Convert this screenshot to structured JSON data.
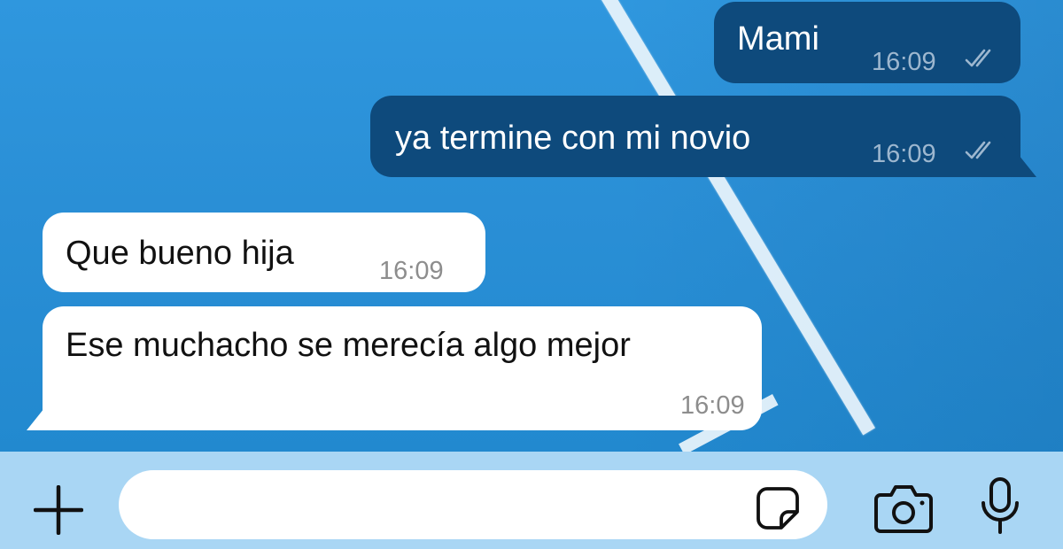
{
  "messages": [
    {
      "direction": "outgoing",
      "text": "Mami",
      "time": "16:09",
      "status_icon": "double-check-icon"
    },
    {
      "direction": "outgoing",
      "text": "ya termine con mi novio",
      "time": "16:09",
      "status_icon": "double-check-icon"
    },
    {
      "direction": "incoming",
      "text": "Que bueno hija",
      "time": "16:09"
    },
    {
      "direction": "incoming",
      "text": "Ese muchacho se merecía algo mejor",
      "time": "16:09"
    }
  ],
  "input": {
    "value": "",
    "placeholder": ""
  },
  "icons": {
    "attach": "plus-icon",
    "sticker": "sticker-icon",
    "camera": "camera-icon",
    "mic": "microphone-icon"
  },
  "colors": {
    "outgoing_bubble": "#0e4a7c",
    "incoming_bubble": "#ffffff",
    "input_bar": "#a9d6f4",
    "wallpaper": "#2b92d9"
  }
}
